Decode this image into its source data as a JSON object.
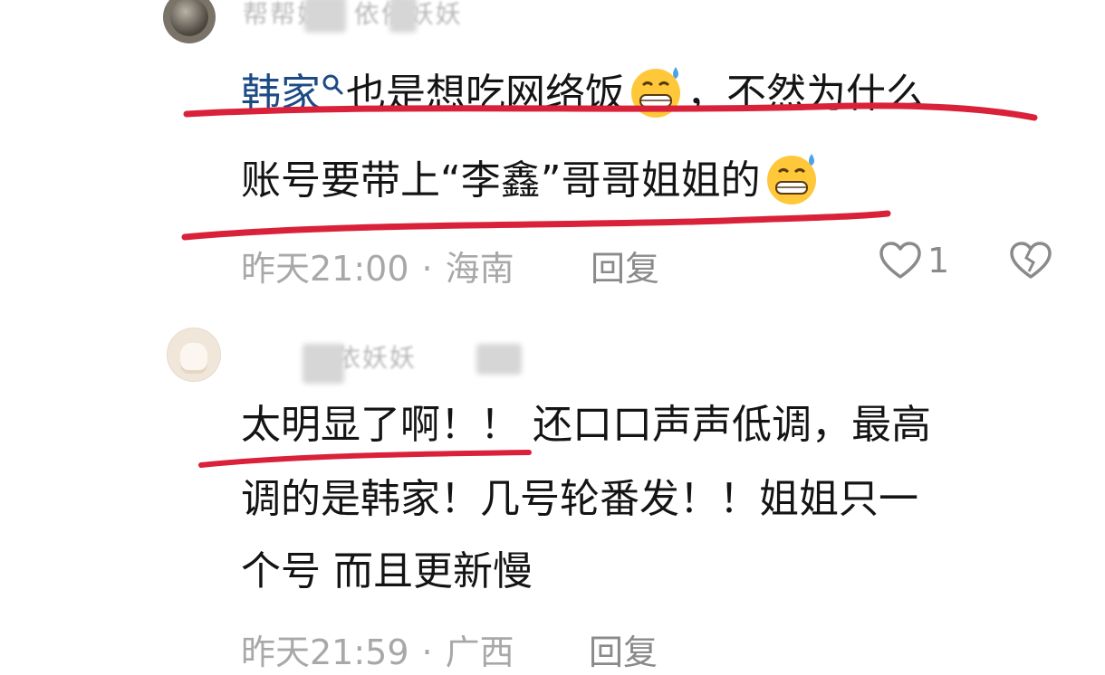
{
  "comments": [
    {
      "username": "帮帮姐 · 依依妖妖",
      "mention": "韩家",
      "line1_rest": "也是想吃网络饭",
      "line1_tail": "，不然为什么",
      "line2": "账号要带上“李鑫”哥哥姐姐的",
      "time": "昨天21:00",
      "location": "海南",
      "reply_label": "回复",
      "like_count": "1"
    },
    {
      "username": "依妖妖",
      "line1": "太明显了啊！！ 还口口声声低调，最高",
      "line2": "调的是韩家！几号轮番发！！姐姐只一",
      "line3": "个号 而且更新慢",
      "time": "昨天21:59",
      "location": "广西",
      "reply_label": "回复"
    }
  ],
  "colors": {
    "mention": "#1d4b86",
    "underline": "#d9213a",
    "meta": "#a8a8a8"
  },
  "icons": [
    "search-icon",
    "grinning-sweat-emoji",
    "heart-icon",
    "broken-heart-icon"
  ]
}
